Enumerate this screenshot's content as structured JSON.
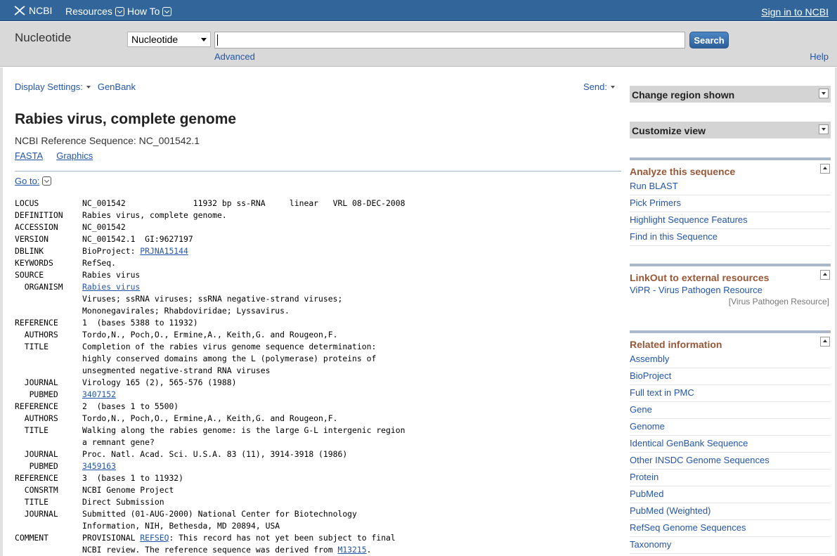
{
  "topbar": {
    "logo": "NCBI",
    "resources": "Resources",
    "howto": "How To",
    "signin": "Sign in to NCBI"
  },
  "search": {
    "db_title": "Nucleotide",
    "db_selected": "Nucleotide",
    "term": "",
    "button": "Search",
    "advanced": "Advanced",
    "help": "Help"
  },
  "display": {
    "settings": "Display Settings:",
    "format": "GenBank",
    "send": "Send:"
  },
  "record": {
    "title": "Rabies virus, complete genome",
    "refseq": "NCBI Reference Sequence: NC_001542.1",
    "fasta": "FASTA",
    "graphics": "Graphics",
    "goto": "Go to:"
  },
  "genbank": [
    {
      "key": "LOCUS",
      "val": "NC_001542              11932 bp ss-RNA     linear   VRL 08-DEC-2008"
    },
    {
      "key": "DEFINITION",
      "val": "Rabies virus, complete genome."
    },
    {
      "key": "ACCESSION",
      "val": "NC_001542"
    },
    {
      "key": "VERSION",
      "val": "NC_001542.1  GI:9627197"
    },
    {
      "key": "DBLINK",
      "val": "BioProject: ",
      "link": "PRJNA15144"
    },
    {
      "key": "KEYWORDS",
      "val": "RefSeq."
    },
    {
      "key": "SOURCE",
      "val": "Rabies virus"
    },
    {
      "key": "  ORGANISM",
      "val": "",
      "link": "Rabies virus"
    },
    {
      "key": "",
      "val": "Viruses; ssRNA viruses; ssRNA negative-strand viruses;"
    },
    {
      "key": "",
      "val": "Mononegavirales; Rhabdoviridae; Lyssavirus."
    },
    {
      "key": "REFERENCE",
      "val": "1  (bases 5388 to 11932)"
    },
    {
      "key": "  AUTHORS",
      "val": "Tordo,N., Poch,O., Ermine,A., Keith,G. and Rougeon,F."
    },
    {
      "key": "  TITLE",
      "val": "Completion of the rabies virus genome sequence determination:"
    },
    {
      "key": "",
      "val": "highly conserved domains among the L (polymerase) proteins of"
    },
    {
      "key": "",
      "val": "unsegmented negative-strand RNA viruses"
    },
    {
      "key": "  JOURNAL",
      "val": "Virology 165 (2), 565-576 (1988)"
    },
    {
      "key": "   PUBMED",
      "val": "",
      "link": "3407152"
    },
    {
      "key": "REFERENCE",
      "val": "2  (bases 1 to 5500)"
    },
    {
      "key": "  AUTHORS",
      "val": "Tordo,N., Poch,O., Ermine,A., Keith,G. and Rougeon,F."
    },
    {
      "key": "  TITLE",
      "val": "Walking along the rabies genome: is the large G-L intergenic region"
    },
    {
      "key": "",
      "val": "a remnant gene?"
    },
    {
      "key": "  JOURNAL",
      "val": "Proc. Natl. Acad. Sci. U.S.A. 83 (11), 3914-3918 (1986)"
    },
    {
      "key": "   PUBMED",
      "val": "",
      "link": "3459163"
    },
    {
      "key": "REFERENCE",
      "val": "3  (bases 1 to 11932)"
    },
    {
      "key": "  CONSRTM",
      "val": "NCBI Genome Project"
    },
    {
      "key": "  TITLE",
      "val": "Direct Submission"
    },
    {
      "key": "  JOURNAL",
      "val": "Submitted (01-AUG-2000) National Center for Biotechnology"
    },
    {
      "key": "",
      "val": "Information, NIH, Bethesda, MD 20894, USA"
    },
    {
      "key": "COMMENT",
      "val": "PROVISIONAL ",
      "link": "REFSEQ",
      "after": ": This record has not yet been subject to final"
    },
    {
      "key": "",
      "val": "NCBI review. The reference sequence was derived from ",
      "link": "M13215",
      "after": "."
    }
  ],
  "sidebar": {
    "change_region": "Change region shown",
    "customize": "Customize view",
    "analyze": {
      "title": "Analyze this sequence",
      "items": [
        "Run BLAST",
        "Pick Primers",
        "Highlight Sequence Features",
        "Find in this Sequence"
      ]
    },
    "linkout": {
      "title": "LinkOut to external resources",
      "item": "ViPR - Virus Pathogen Resource",
      "source": "[Virus Pathogen Resource]"
    },
    "related": {
      "title": "Related information",
      "items": [
        "Assembly",
        "BioProject",
        "Full text in PMC",
        "Gene",
        "Genome",
        "Identical GenBank Sequence",
        "Other INSDC Genome Sequences",
        "Protein",
        "PubMed",
        "PubMed (Weighted)",
        "RefSeq Genome Sequences",
        "Taxonomy"
      ]
    }
  }
}
